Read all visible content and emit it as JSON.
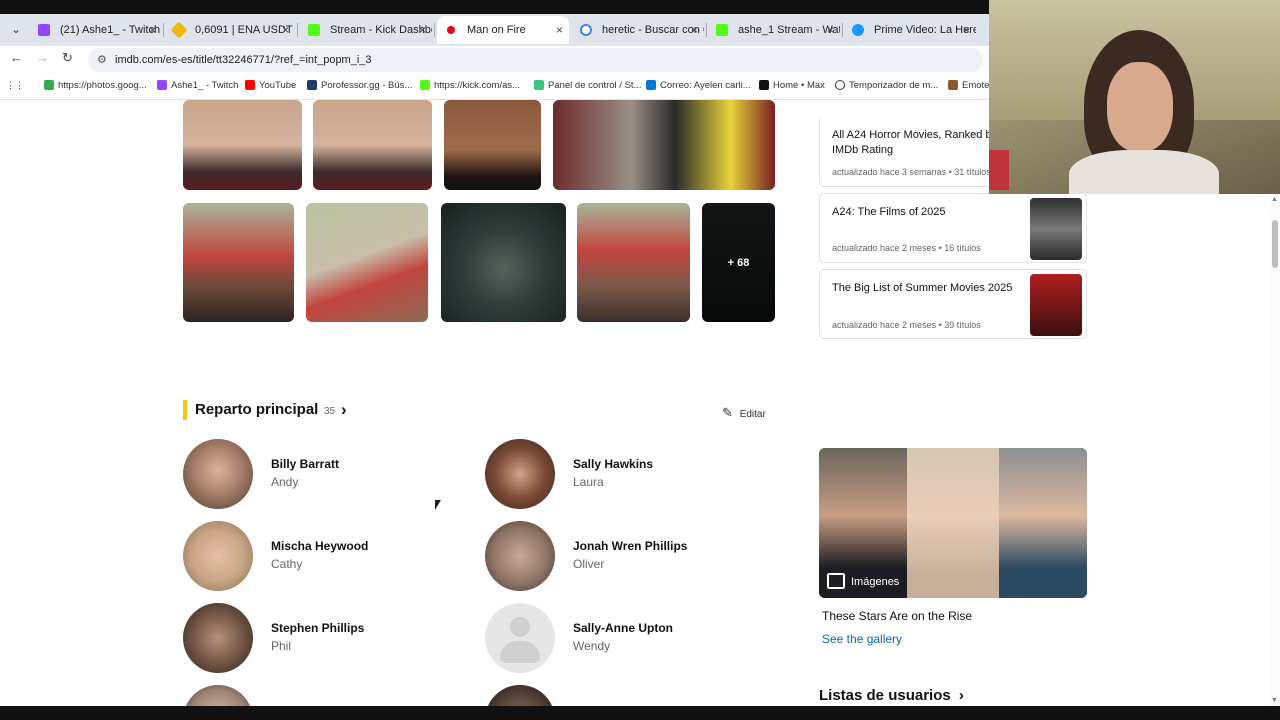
{
  "browser": {
    "tabs": [
      {
        "title": "(21) Ashe1_ - Twitch",
        "color": "#9146ff"
      },
      {
        "title": "0,6091 | ENA USDT | E",
        "color": "#f0b90b"
      },
      {
        "title": "Stream - Kick Dashbo",
        "color": "#53fc18"
      },
      {
        "title": "Man on Fire",
        "color": "#e50914"
      },
      {
        "title": "heretic - Buscar con G",
        "color": "#4285f4"
      },
      {
        "title": "ashe_1 Stream - Watc",
        "color": "#53fc18"
      },
      {
        "title": "Prime Video: La Here",
        "color": "#1a98ff"
      }
    ],
    "tab_close": "×",
    "tab_dropdown": "⌄",
    "back": "←",
    "forward": "→",
    "reload": "↻",
    "url": "imdb.com/es-es/title/tt32246771/?ref_=int_popm_i_3",
    "site_info_icon": "⚙",
    "apps_icon": "⋮⋮",
    "bookmarks": [
      {
        "label": "https://photos.goog...",
        "color": "#34a853"
      },
      {
        "label": "Ashe1_ - Twitch",
        "color": "#9146ff"
      },
      {
        "label": "YouTube",
        "color": "#ff0000"
      },
      {
        "label": "Porofessor.gg - Bús...",
        "color": "#1d3c6c"
      },
      {
        "label": "https://kick.com/as...",
        "color": "#53fc18"
      },
      {
        "label": "Panel de control / St...",
        "color": "#3ac47d"
      },
      {
        "label": "Correo: Ayelen carli...",
        "color": "#0078d4"
      },
      {
        "label": "Home • Max",
        "color": "#111111"
      },
      {
        "label": "Temporizador de m...",
        "color": "#333333"
      },
      {
        "label": "Emote",
        "color": "#8b5a2b"
      }
    ]
  },
  "photos": {
    "more_label": "+ 68"
  },
  "lists": [
    {
      "title": "All A24 Horror Movies, Ranked by IMDb Rating",
      "meta": "actualizado hace 3 semanas • 31 títulos",
      "thumb_color": "#444444"
    },
    {
      "title": "A24: The Films of 2025",
      "meta": "actualizado hace 2 meses • 16 títulos",
      "thumb_color": "#2f2f2f"
    },
    {
      "title": "The Big List of Summer Movies 2025",
      "meta": "actualizado hace 2 meses • 39 títulos",
      "thumb_color": "#b0201f"
    }
  ],
  "cast_section": {
    "title": "Reparto principal",
    "count": "35",
    "chevron": "›",
    "edit_label": "Editar",
    "edit_icon": "✎"
  },
  "cast": [
    {
      "name": "Billy Barratt",
      "role": "Andy",
      "avatar_color": "#a77f6a"
    },
    {
      "name": "Sally Hawkins",
      "role": "Laura",
      "avatar_color": "#7a4a36"
    },
    {
      "name": "Mischa Heywood",
      "role": "Cathy",
      "avatar_color": "#c9a787"
    },
    {
      "name": "Jonah Wren Phillips",
      "role": "Oliver",
      "avatar_color": "#8f7565"
    },
    {
      "name": "Stephen Phillips",
      "role": "Phil",
      "avatar_color": "#6d5142"
    },
    {
      "name": "Sally-Anne Upton",
      "role": "Wendy",
      "avatar_color": "#dcdcdc"
    }
  ],
  "gallery": {
    "label": "Imágenes",
    "caption": "These Stars Are on the Rise",
    "link": "See the gallery"
  },
  "user_lists_title": "Listas de usuarios",
  "colors": {
    "accent": "#f5c518",
    "link": "#0e63be"
  }
}
